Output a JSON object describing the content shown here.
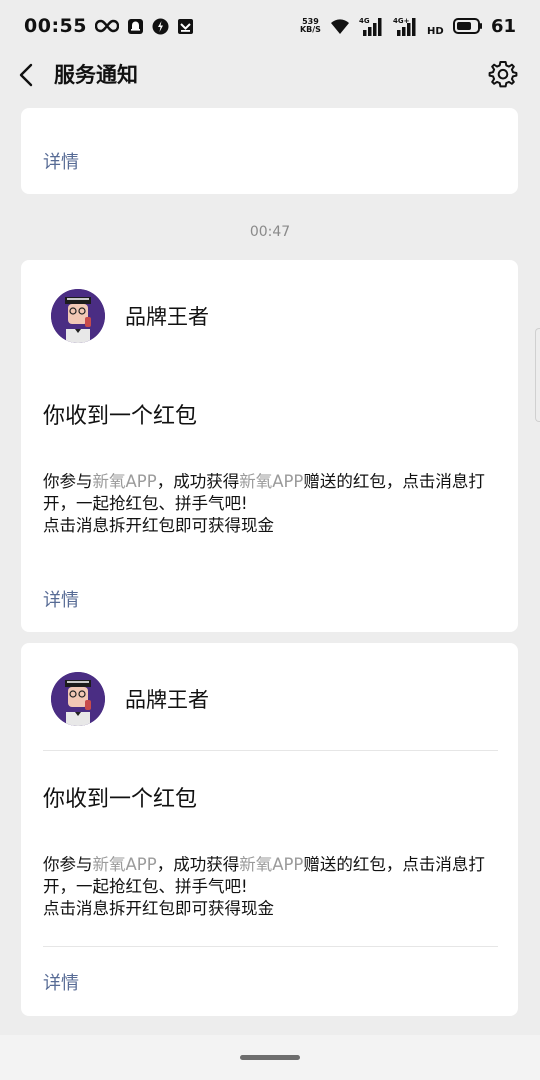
{
  "status_bar": {
    "time": "00:55",
    "net_speed_value": "539",
    "net_speed_unit": "KB/S",
    "signal1_label": "4G",
    "signal2_label": "4G+",
    "hd_label": "HD",
    "battery": "61",
    "icons": [
      "infinity-icon",
      "notification-icon",
      "app-icon",
      "download-icon",
      "wifi-icon",
      "signal-icon",
      "battery-icon"
    ]
  },
  "nav": {
    "title": "服务通知",
    "back_icon": "back-icon",
    "settings_icon": "gear-icon"
  },
  "top_card": {
    "link": "详情"
  },
  "timestamp": "00:47",
  "messages": [
    {
      "sender": "品牌王者",
      "title": "你收到一个红包",
      "body_parts": [
        "你参与",
        "新氧APP",
        "，成功获得",
        "新氧APP",
        "赠送的红包，点击消息打开，一起抢红包、拼手气吧!"
      ],
      "body_line3": "点击消息拆开红包即可获得现金",
      "link": "详情"
    },
    {
      "sender": "品牌王者",
      "title": "你收到一个红包",
      "body_parts": [
        "你参与",
        "新氧APP",
        "，成功获得",
        "新氧APP",
        "赠送的红包，点击消息打开，一起抢红包、拼手气吧!"
      ],
      "body_line3": "点击消息拆开红包即可获得现金",
      "link": "详情"
    }
  ],
  "colors": {
    "background": "#ededed",
    "card": "#ffffff",
    "link": "#576b95",
    "muted": "#9b9b9b",
    "avatar_bg": "#4a2d83"
  }
}
